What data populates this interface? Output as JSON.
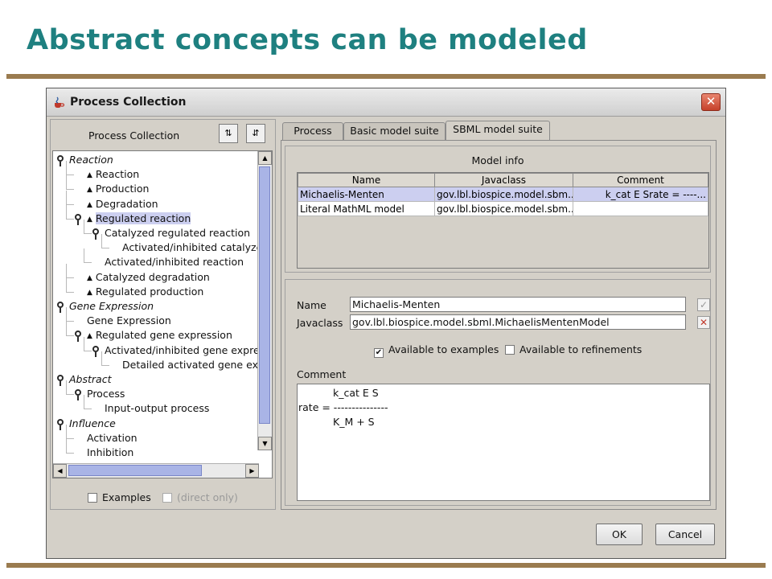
{
  "slide": {
    "title": "Abstract concepts can be modeled"
  },
  "window": {
    "title": "Process Collection",
    "close_label": "✕"
  },
  "left_panel": {
    "header": "Process Collection",
    "sort_asc_icon": "sort-ascending-icon",
    "sort_desc_icon": "sort-descending-icon",
    "tree": [
      {
        "label": "Reaction",
        "kind": "category"
      },
      {
        "label": "Reaction",
        "kind": "leaf"
      },
      {
        "label": "Production",
        "kind": "leaf"
      },
      {
        "label": "Degradation",
        "kind": "leaf"
      },
      {
        "label": "Regulated reaction",
        "kind": "leaf",
        "selected": true
      },
      {
        "label": "Catalyzed regulated reaction",
        "kind": "leaf"
      },
      {
        "label": "Activated/inhibited catalyze",
        "kind": "leaf"
      },
      {
        "label": "Activated/inhibited reaction",
        "kind": "leaf"
      },
      {
        "label": "Catalyzed degradation",
        "kind": "leaf"
      },
      {
        "label": "Regulated production",
        "kind": "leaf"
      },
      {
        "label": "Gene Expression",
        "kind": "category"
      },
      {
        "label": "Gene Expression",
        "kind": "leaf"
      },
      {
        "label": "Regulated gene expression",
        "kind": "leaf"
      },
      {
        "label": "Activated/inhibited gene expres",
        "kind": "leaf"
      },
      {
        "label": "Detailed activated gene exp",
        "kind": "leaf"
      },
      {
        "label": "Abstract",
        "kind": "category"
      },
      {
        "label": "Process",
        "kind": "leaf"
      },
      {
        "label": "Input-output process",
        "kind": "leaf"
      },
      {
        "label": "Influence",
        "kind": "category"
      },
      {
        "label": "Activation",
        "kind": "leaf"
      },
      {
        "label": "Inhibition",
        "kind": "leaf"
      }
    ],
    "examples_label": "Examples",
    "direct_only_label": "(direct only)"
  },
  "tabs": [
    {
      "label": "Process",
      "active": false
    },
    {
      "label": "Basic model suite",
      "active": false
    },
    {
      "label": "SBML model suite",
      "active": true
    }
  ],
  "model_info": {
    "title": "Model info",
    "columns": [
      "Name",
      "Javaclass",
      "Comment"
    ],
    "rows": [
      {
        "name": "Michaelis-Menten",
        "javaclass": "gov.lbl.biospice.model.sbm...",
        "comment": "k_cat E Srate = ----...",
        "selected": true
      },
      {
        "name": "Literal MathML model",
        "javaclass": "gov.lbl.biospice.model.sbm...",
        "comment": "",
        "selected": false
      }
    ]
  },
  "detail": {
    "name_label": "Name",
    "name_value": "Michaelis-Menten",
    "javaclass_label": "Javaclass",
    "javaclass_value": "gov.lbl.biospice.model.sbml.MichaelisMentenModel",
    "available_examples_label": "Available to examples",
    "available_examples_checked": true,
    "available_refinements_label": "Available to refinements",
    "available_refinements_checked": false,
    "comment_label": "Comment",
    "comment_lines": [
      "k_cat E S",
      "rate = ---------------",
      "K_M + S"
    ]
  },
  "buttons": {
    "ok": "OK",
    "cancel": "Cancel"
  }
}
